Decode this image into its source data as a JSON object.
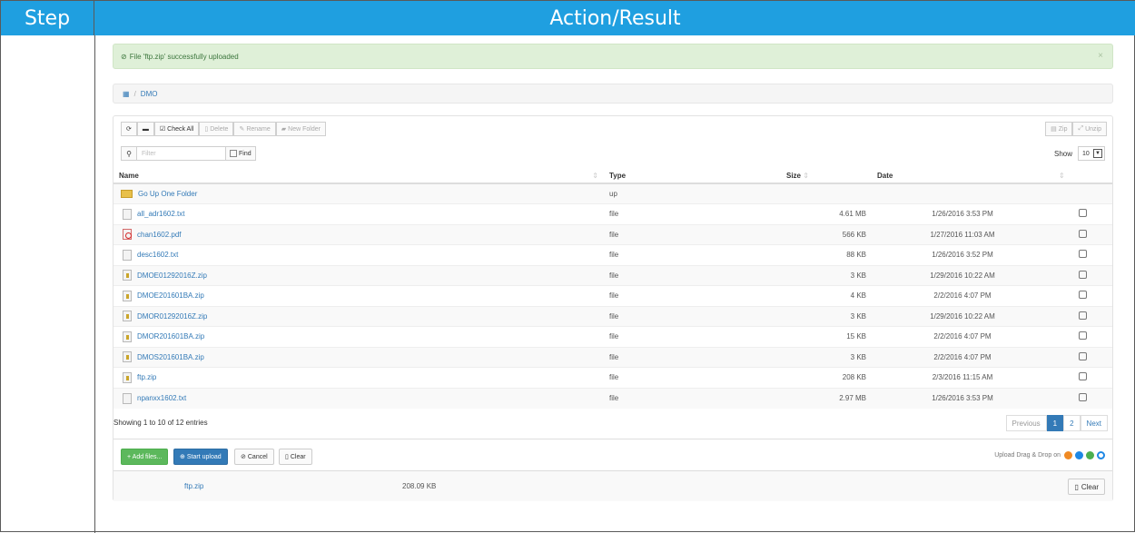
{
  "doc_table": {
    "col_step": "Step",
    "col_action": "Action/Result"
  },
  "alert": {
    "icon": "check-circle-icon",
    "text": "File 'ftp.zip' successfully uploaded",
    "close": "×"
  },
  "breadcrumb": {
    "home_icon": "home-icon",
    "separator": "/",
    "current": "DMO"
  },
  "toolbar": {
    "refresh_icon": "refresh-icon",
    "image_icon": "image-icon",
    "check_all": "Check All",
    "delete": "Delete",
    "rename": "Rename",
    "new_folder": "New Folder",
    "zip": "Zip",
    "unzip": "Unzip"
  },
  "filter": {
    "placeholder": "Filter",
    "find": "Find",
    "show_label": "Show",
    "show_value": "10"
  },
  "table": {
    "columns": [
      "Name",
      "Type",
      "Size",
      "Date"
    ],
    "rows": [
      {
        "name": "Go Up One Folder",
        "type": "up",
        "size": "",
        "date": "",
        "icon": "folder"
      },
      {
        "name": "all_adr1602.txt",
        "type": "file",
        "size": "4.61 MB",
        "date": "1/26/2016 3:53 PM",
        "icon": "txt"
      },
      {
        "name": "chan1602.pdf",
        "type": "file",
        "size": "566 KB",
        "date": "1/27/2016 11:03 AM",
        "icon": "pdf"
      },
      {
        "name": "desc1602.txt",
        "type": "file",
        "size": "88 KB",
        "date": "1/26/2016 3:52 PM",
        "icon": "txt"
      },
      {
        "name": "DMOE01292016Z.zip",
        "type": "file",
        "size": "3 KB",
        "date": "1/29/2016 10:22 AM",
        "icon": "zip"
      },
      {
        "name": "DMOE201601BA.zip",
        "type": "file",
        "size": "4 KB",
        "date": "2/2/2016 4:07 PM",
        "icon": "zip"
      },
      {
        "name": "DMOR01292016Z.zip",
        "type": "file",
        "size": "3 KB",
        "date": "1/29/2016 10:22 AM",
        "icon": "zip"
      },
      {
        "name": "DMOR201601BA.zip",
        "type": "file",
        "size": "15 KB",
        "date": "2/2/2016 4:07 PM",
        "icon": "zip"
      },
      {
        "name": "DMOS201601BA.zip",
        "type": "file",
        "size": "3 KB",
        "date": "2/2/2016 4:07 PM",
        "icon": "zip"
      },
      {
        "name": "ftp.zip",
        "type": "file",
        "size": "208 KB",
        "date": "2/3/2016 11:15 AM",
        "icon": "zip"
      },
      {
        "name": "npanxx1602.txt",
        "type": "file",
        "size": "2.97 MB",
        "date": "1/26/2016 3:53 PM",
        "icon": "txt"
      }
    ]
  },
  "footer": {
    "info": "Showing 1 to 10 of 12 entries",
    "prev": "Previous",
    "page1": "1",
    "page2": "2",
    "next": "Next"
  },
  "upload": {
    "add_files": "+ Add files...",
    "start_upload": "Start upload",
    "cancel": "Cancel",
    "clear": "Clear",
    "dnd_text": "Upload Drag & Drop on",
    "file_name": "ftp.zip",
    "file_size": "208.09 KB",
    "row_clear": "Clear"
  },
  "colors": {
    "header_blue": "#1f9fe0",
    "alert_green": "#dff0d8",
    "link_blue": "#337ab7",
    "add_green": "#5cb85c"
  }
}
